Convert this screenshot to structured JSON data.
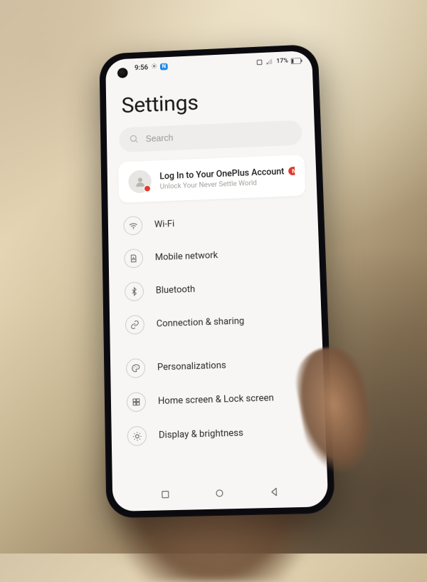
{
  "status": {
    "time": "9:56",
    "badge_text": "N",
    "battery_text": "17%"
  },
  "header": {
    "title": "Settings"
  },
  "search": {
    "placeholder": "Search"
  },
  "account": {
    "title": "Log In to Your OnePlus Account",
    "badge": "New",
    "subtitle": "Unlock Your Never Settle World"
  },
  "rows": {
    "wifi": "Wi-Fi",
    "mobile": "Mobile network",
    "bluetooth": "Bluetooth",
    "conn": "Connection & sharing",
    "pers": "Personalizations",
    "home": "Home screen & Lock screen",
    "display": "Display & brightness"
  }
}
